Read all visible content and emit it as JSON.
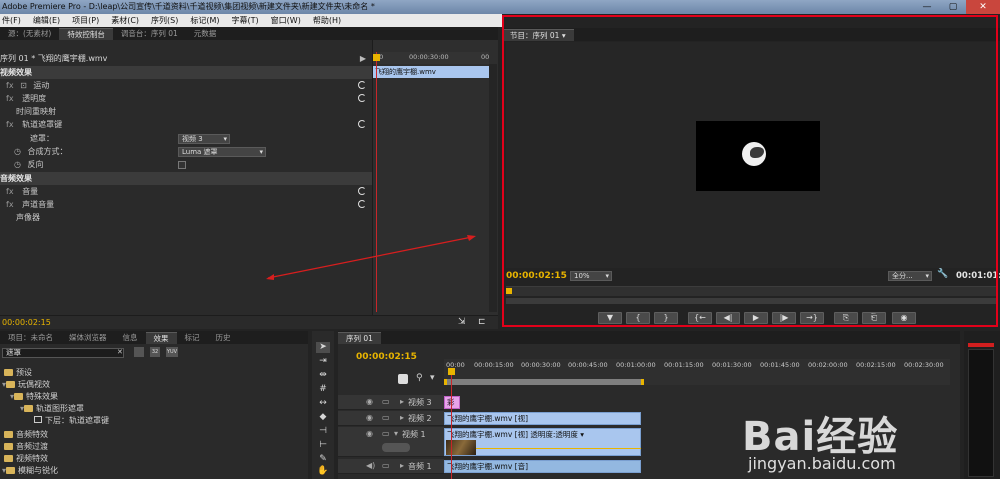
{
  "app": {
    "title": "Adobe Premiere Pro - D:\\leap\\公司宣传\\千道资料\\千道视频\\集团视频\\新建文件夹\\新建文件夹\\未命名 *"
  },
  "menu": [
    "件(F)",
    "编辑(E)",
    "项目(P)",
    "素材(C)",
    "序列(S)",
    "标记(M)",
    "字幕(T)",
    "窗口(W)",
    "帮助(H)"
  ],
  "effect_controls": {
    "tabs": [
      "源：(无素材)",
      "特效控制台",
      "调音台：序列 01",
      "元数据"
    ],
    "clip_title": "序列 01 * 飞翔的鹰宇棚.wmv",
    "video_effects_header": "视频效果",
    "items": {
      "motion": "运动",
      "opacity": "透明度",
      "time_remap": "时间重映射",
      "track_matte": "轨道遮罩键",
      "audio_effects_header": "音频效果",
      "volume": "音量",
      "channel_volume": "声道音量",
      "panner": "声像器"
    },
    "matte_label": "遮罩：",
    "matte_value": "视频 3",
    "composite_label": "合成方式：",
    "composite_value": "Luma 遮罩",
    "reverse_label": "反向",
    "timecode": "00:00:02:15",
    "mini_timeline": {
      "tc_start": "00",
      "tc_mid": "00:00:30:00",
      "tc_end": "00",
      "clip": "飞翔的鹰宇棚.wmv"
    }
  },
  "program_monitor": {
    "tab": "节目：序列 01",
    "timecode": "00:00:02:15",
    "zoom": "10%",
    "fit": "全分...",
    "duration": "00:01:01:",
    "buttons": [
      "▼",
      "{",
      "}",
      "{←",
      "◀|",
      "▶",
      "|▶",
      "→}",
      "⎘",
      "⎗",
      "◉"
    ]
  },
  "project_panel": {
    "tabs": [
      "项目：未命名",
      "媒体浏览器",
      "信息",
      "效果",
      "标记",
      "历史"
    ],
    "search_value": "遮罩",
    "tree": [
      "预设",
      "玩偶视效",
      "特殊效果",
      "轨道图形遮罩",
      "下层：轨道遮罩键",
      "音频特效",
      "音频过渡",
      "视频特效",
      "模糊与锐化"
    ]
  },
  "timeline": {
    "tab": "序列 01",
    "timecode": "00:00:02:15",
    "ruler": [
      "00:00",
      "00:00:15:00",
      "00:00:30:00",
      "00:00:45:00",
      "00:01:00:00",
      "00:01:15:00",
      "00:01:30:00",
      "00:01:45:00",
      "00:02:00:00",
      "00:02:15:00",
      "00:02:30:00"
    ],
    "tracks": {
      "v3": "视频 3",
      "v2": "视频 2",
      "v1": "视频 1",
      "a1": "音频 1"
    },
    "clips": {
      "v3": "彩",
      "v2": "飞翔的鹰宇棚.wmv [视]",
      "v1": "飞翔的鹰宇棚.wmv [视] 透明度:透明度 ▾",
      "a1": "飞翔的鹰宇棚.wmv [音]"
    }
  },
  "watermark": {
    "brand": "Bai经验",
    "url": "jingyan.baidu.com"
  },
  "colors": {
    "highlight_border": "#e2001a",
    "timecode": "#e8b400",
    "annotation_arrow": "#d81e1e",
    "clip_video": "#a9c6ee",
    "clip_pink": "#e7a3ea"
  }
}
